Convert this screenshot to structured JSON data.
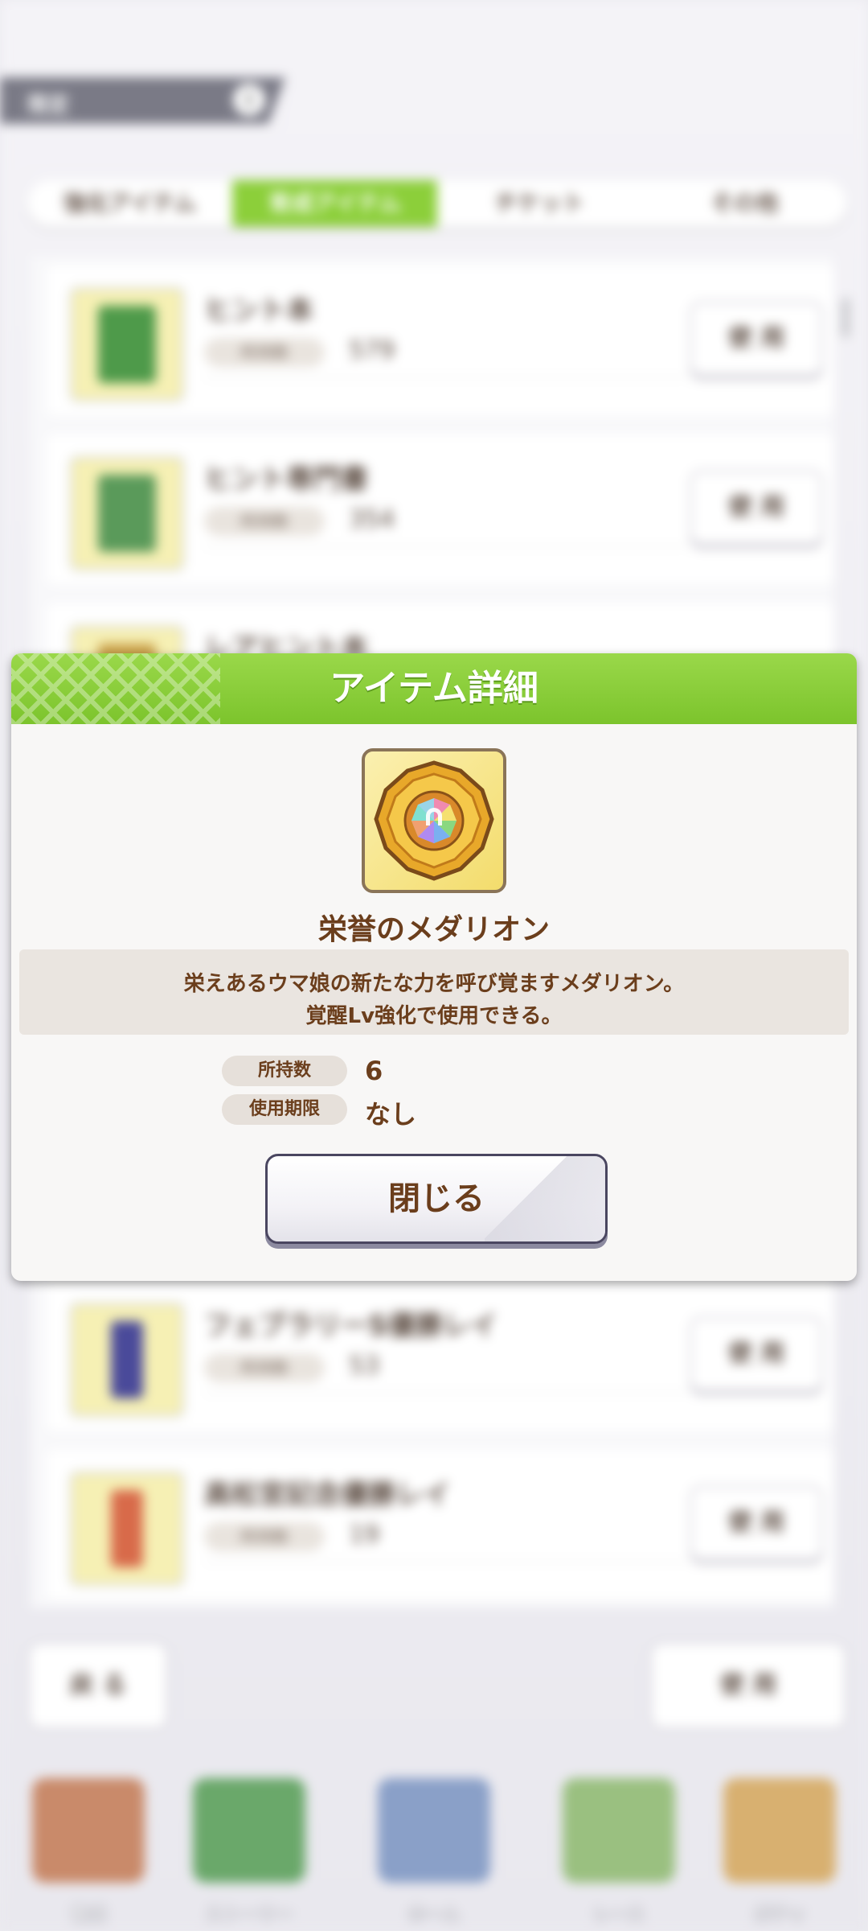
{
  "background": {
    "header_title": "限定",
    "header_badge": "i",
    "tabs": [
      {
        "label": "強化アイテム",
        "active": false
      },
      {
        "label": "育成アイテム",
        "active": true
      },
      {
        "label": "チケット",
        "active": false
      },
      {
        "label": "その他",
        "active": false
      }
    ],
    "count_label": "所持数",
    "use_label": "使 用",
    "rows": [
      {
        "name": "ヒント本",
        "count": "579",
        "thumb_color": "#4e9a4a"
      },
      {
        "name": "ヒント専門書",
        "count": "354",
        "thumb_color": "#5a9a5a"
      },
      {
        "name": "レアヒント本",
        "count": "",
        "thumb_color": "#c9a04a"
      },
      {
        "name": "フェブラリーS優勝レイ",
        "count": "53",
        "thumb_color": "#4a4a9a"
      },
      {
        "name": "高松宮記念優勝レイ",
        "count": "19",
        "thumb_color": "#d86a4a"
      }
    ],
    "back_label": "戻 る",
    "confirm_label": "使 用",
    "nav": [
      {
        "label": "育成"
      },
      {
        "label": "ストーリー"
      },
      {
        "label": "ホーム"
      },
      {
        "label": "レース"
      },
      {
        "label": "ガチャ"
      }
    ]
  },
  "dialog": {
    "title": "アイテム詳細",
    "item_name": "栄誉のメダリオン",
    "description_line1": "栄えあるウマ娘の新たな力を呼び覚ますメダリオン。",
    "description_line2": "覚醒Lv強化で使用できる。",
    "owned_label": "所持数",
    "owned_value": "6",
    "expiry_label": "使用期限",
    "expiry_value": "なし",
    "close_label": "閉じる",
    "icon": "medallion-icon"
  },
  "colors": {
    "header_green": "#7cc42c",
    "text_brown": "#6b3e1c",
    "tab_active": "#8ccf3a"
  }
}
